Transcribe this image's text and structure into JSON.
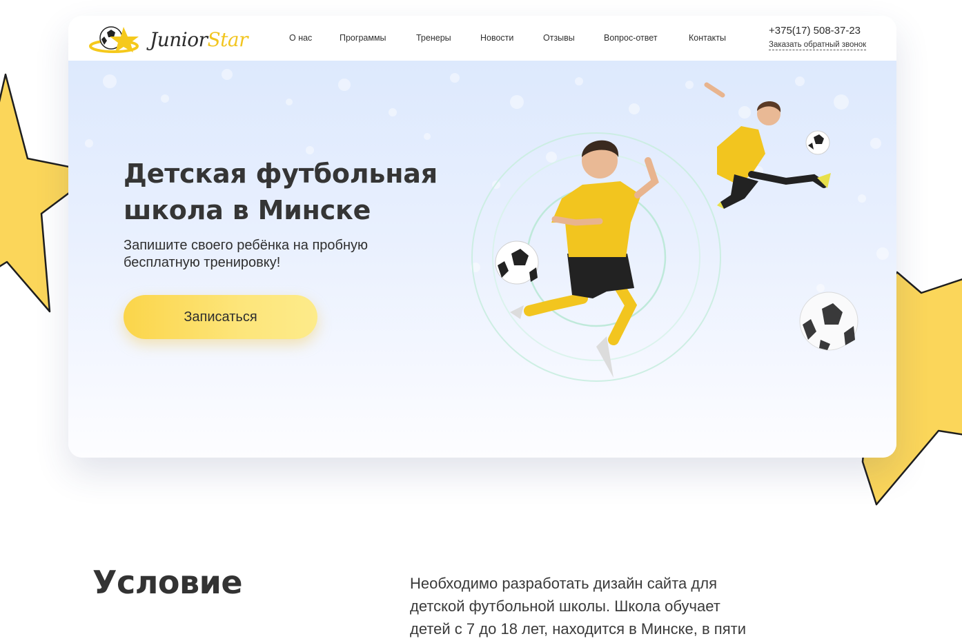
{
  "brand": {
    "logo_part1": "Junior",
    "logo_part2": "Star",
    "accent_yellow": "#f2c51f",
    "text_dark": "#353535"
  },
  "nav": {
    "items": [
      {
        "label": "О нас"
      },
      {
        "label": "Программы"
      },
      {
        "label": "Тренеры"
      },
      {
        "label": "Новости"
      },
      {
        "label": "Отзывы"
      },
      {
        "label": "Вопрос-ответ"
      },
      {
        "label": "Контакты"
      }
    ]
  },
  "contact": {
    "phone": "+375(17) 508-37-23",
    "callback_label": "Заказать обратный звонок"
  },
  "hero": {
    "title_line1": "Детская футбольная",
    "title_line2": "школа в Минске",
    "subtitle_line1": "Запишите своего ребёнка на пробную",
    "subtitle_line2": "бесплатную тренировку!",
    "cta_label": "Записаться"
  },
  "condition": {
    "title": "Условие",
    "text_line1": "Необходимо разработать дизайн сайта для",
    "text_line2": "детской футбольной школы. Школа обучает",
    "text_line3": "детей с 7 до 18 лет, находится в Минске, в пяти"
  },
  "icons": [
    "soccer-ball-icon",
    "star-icon"
  ]
}
